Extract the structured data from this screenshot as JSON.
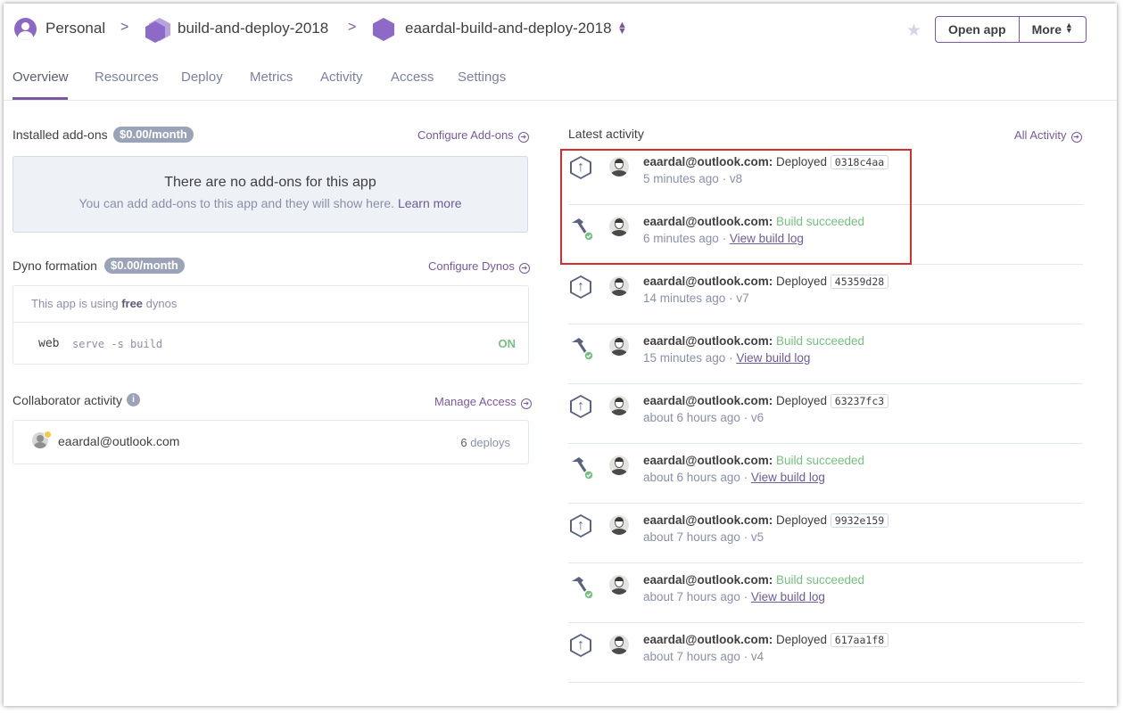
{
  "header": {
    "personal_label": "Personal",
    "pipeline_label": "build-and-deploy-2018",
    "app_label": "eaardal-build-and-deploy-2018",
    "open_app_label": "Open app",
    "more_label": "More"
  },
  "tabs": [
    {
      "label": "Overview"
    },
    {
      "label": "Resources"
    },
    {
      "label": "Deploy"
    },
    {
      "label": "Metrics"
    },
    {
      "label": "Activity"
    },
    {
      "label": "Access"
    },
    {
      "label": "Settings"
    }
  ],
  "addons": {
    "title": "Installed add-ons",
    "cost": "$0.00/month",
    "link": "Configure Add-ons",
    "empty_title": "There are no add-ons for this app",
    "empty_sub": "You can add add-ons to this app and they will show here.",
    "learn_more": "Learn more"
  },
  "dynos": {
    "title": "Dyno formation",
    "cost": "$0.00/month",
    "link": "Configure Dynos",
    "note_prefix": "This app is using",
    "note_bold": "free",
    "note_suffix": "dynos",
    "name": "web",
    "command": "serve -s build",
    "status": "ON"
  },
  "collaborators": {
    "title": "Collaborator activity",
    "link": "Manage Access",
    "email": "eaardal@outlook.com",
    "deploy_count": "6",
    "deploy_label": "deploys"
  },
  "activity": {
    "title": "Latest activity",
    "link": "All Activity",
    "items": [
      {
        "type": "deploy",
        "user": "eaardal@outlook.com:",
        "action": "Deployed",
        "commit": "0318c4aa",
        "time": "5 minutes ago",
        "sep": "·",
        "version": "v8"
      },
      {
        "type": "build",
        "user": "eaardal@outlook.com:",
        "action": "Build succeeded",
        "time": "6 minutes ago",
        "sep": "·",
        "link": "View build log"
      },
      {
        "type": "deploy",
        "user": "eaardal@outlook.com:",
        "action": "Deployed",
        "commit": "45359d28",
        "time": "14 minutes ago",
        "sep": "·",
        "version": "v7"
      },
      {
        "type": "build",
        "user": "eaardal@outlook.com:",
        "action": "Build succeeded",
        "time": "15 minutes ago",
        "sep": "·",
        "link": "View build log"
      },
      {
        "type": "deploy",
        "user": "eaardal@outlook.com:",
        "action": "Deployed",
        "commit": "63237fc3",
        "time": "about 6 hours ago",
        "sep": "·",
        "version": "v6"
      },
      {
        "type": "build",
        "user": "eaardal@outlook.com:",
        "action": "Build succeeded",
        "time": "about 6 hours ago",
        "sep": "·",
        "link": "View build log"
      },
      {
        "type": "deploy",
        "user": "eaardal@outlook.com:",
        "action": "Deployed",
        "commit": "9932e159",
        "time": "about 7 hours ago",
        "sep": "·",
        "version": "v5"
      },
      {
        "type": "build",
        "user": "eaardal@outlook.com:",
        "action": "Build succeeded",
        "time": "about 7 hours ago",
        "sep": "·",
        "link": "View build log"
      },
      {
        "type": "deploy",
        "user": "eaardal@outlook.com:",
        "action": "Deployed",
        "commit": "617aa1f8",
        "time": "about 7 hours ago",
        "sep": "·",
        "version": "v4"
      }
    ]
  },
  "colors": {
    "accent": "#79589f",
    "success": "#74c080",
    "highlight": "#d32f2f"
  },
  "icons": [
    "user-icon",
    "app-stack-icon",
    "app-hex-icon",
    "sort-icon",
    "star-icon",
    "arrow-circle-icon",
    "info-icon",
    "deploy-icon",
    "build-hammer-icon",
    "check-badge-icon",
    "avatar"
  ]
}
